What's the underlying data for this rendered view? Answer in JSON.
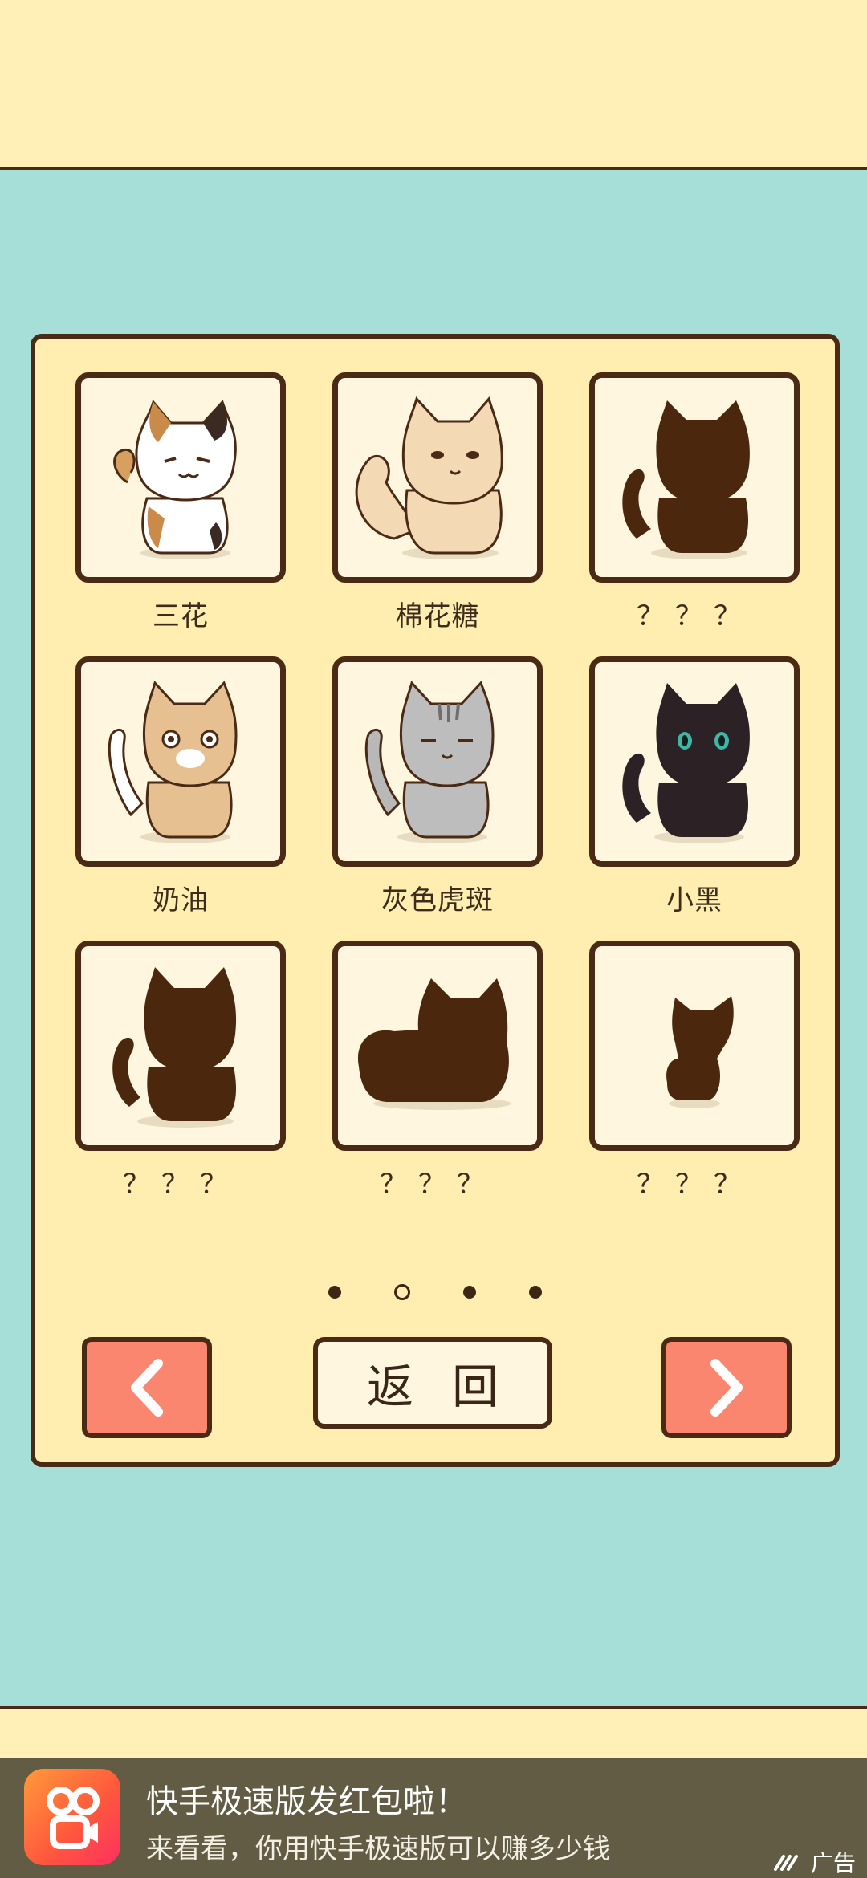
{
  "gallery": {
    "cells": [
      {
        "label": "三花",
        "cat": "calico",
        "locked": false
      },
      {
        "label": "棉花糖",
        "cat": "fluffy-cream",
        "locked": false
      },
      {
        "label": "？？？",
        "cat": "silhouette",
        "locked": true
      },
      {
        "label": "奶油",
        "cat": "cream",
        "locked": false
      },
      {
        "label": "灰色虎斑",
        "cat": "gray-tabby",
        "locked": false
      },
      {
        "label": "小黑",
        "cat": "black",
        "locked": false
      },
      {
        "label": "？？？",
        "cat": "silhouette",
        "locked": true
      },
      {
        "label": "？？？",
        "cat": "silhouette-loaf",
        "locked": true
      },
      {
        "label": "？？？",
        "cat": "silhouette-kitten",
        "locked": true
      }
    ],
    "page_indicator": {
      "pages": 4,
      "current": 2
    }
  },
  "controls": {
    "prev_icon": "chevron-left-icon",
    "next_icon": "chevron-right-icon",
    "back_label": "返回"
  },
  "ad": {
    "app_icon": "kuaishou-app-icon",
    "title": "快手极速版发红包啦！",
    "subtitle": "来看看，你用快手极速版可以赚多少钱",
    "tag": "广告"
  },
  "colors": {
    "background": "#a6dfd8",
    "panel": "#ffeeb0",
    "outline": "#4a2a14",
    "nav_button": "#fb8670",
    "silhouette": "#4a270d"
  }
}
